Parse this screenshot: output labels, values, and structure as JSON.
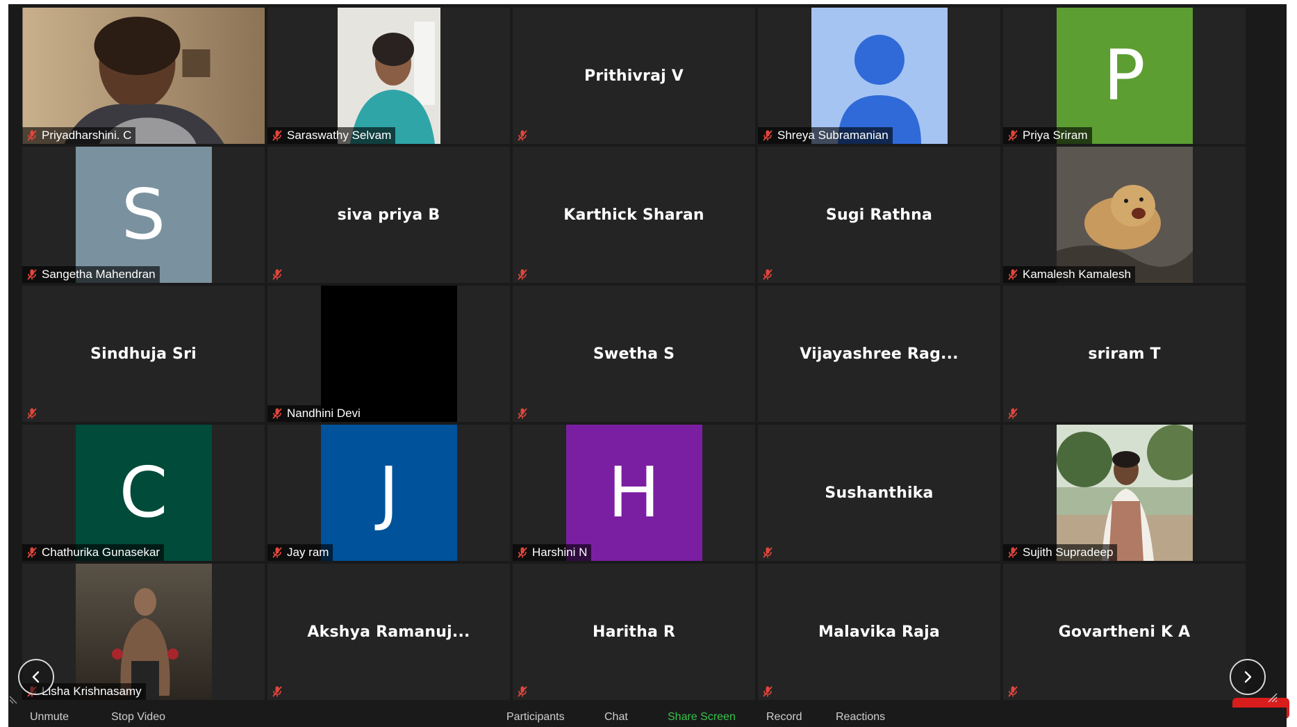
{
  "participants": [
    {
      "name": "Priyadharshini. C",
      "type": "video",
      "media": "photo-woman-1",
      "muted": true
    },
    {
      "name": "Saraswathy Selvam",
      "type": "video",
      "media": "photo-woman-2",
      "muted": true
    },
    {
      "name": "Prithivraj V",
      "type": "name-only",
      "muted": true
    },
    {
      "name": "Shreya Subramanian",
      "type": "avatar-default",
      "muted": true
    },
    {
      "name": "Priya Sriram",
      "type": "letter",
      "letter": "P",
      "color": "#5c9e32",
      "muted": true
    },
    {
      "name": "Sangetha Mahendran",
      "type": "letter",
      "letter": "S",
      "color": "#7a929f",
      "muted": true
    },
    {
      "name": "siva priya B",
      "type": "name-only",
      "muted": true
    },
    {
      "name": "Karthick Sharan",
      "type": "name-only",
      "muted": true
    },
    {
      "name": "Sugi Rathna",
      "type": "name-only",
      "muted": true
    },
    {
      "name": "Kamalesh Kamalesh",
      "type": "video",
      "media": "photo-lion-cub",
      "muted": true
    },
    {
      "name": "Sindhuja Sri",
      "type": "name-only",
      "muted": true
    },
    {
      "name": "Nandhini Devi",
      "type": "video",
      "media": "black-screen",
      "muted": true
    },
    {
      "name": "Swetha S",
      "type": "name-only",
      "muted": true
    },
    {
      "name": "Vijayashree  Rag...",
      "type": "name-only",
      "muted": false
    },
    {
      "name": "sriram T",
      "type": "name-only",
      "muted": true
    },
    {
      "name": "Chathurika Gunasekar",
      "type": "letter",
      "letter": "C",
      "color": "#004b3a",
      "muted": true
    },
    {
      "name": "Jay ram",
      "type": "letter",
      "letter": "J",
      "color": "#00529b",
      "muted": true
    },
    {
      "name": "Harshini N",
      "type": "letter",
      "letter": "H",
      "color": "#7b1fa2",
      "muted": true
    },
    {
      "name": "Sushanthika",
      "type": "name-only",
      "muted": true
    },
    {
      "name": "Sujith Supradeep",
      "type": "video",
      "media": "photo-man-outdoor",
      "muted": true
    },
    {
      "name": "Lisha Krishnasamy",
      "type": "video",
      "media": "photo-movie-poster",
      "muted": true
    },
    {
      "name": "Akshya  Ramanuj...",
      "type": "name-only",
      "muted": true
    },
    {
      "name": "Haritha R",
      "type": "name-only",
      "muted": true
    },
    {
      "name": "Malavika Raja",
      "type": "name-only",
      "muted": true
    },
    {
      "name": "Govartheni K A",
      "type": "name-only",
      "muted": true
    }
  ],
  "toolbar": {
    "unmute": "Unmute",
    "stop_video": "Stop Video",
    "participants": "Participants",
    "chat": "Chat",
    "share_screen": "Share Screen",
    "record": "Record",
    "reactions": "Reactions"
  },
  "nav": {
    "prev_icon": "chevron-left-icon",
    "next_icon": "chevron-right-icon"
  },
  "colors": {
    "background": "#1a1a1a",
    "tile": "#242424",
    "share_screen": "#37c24a",
    "muted_mic": "#e0463c"
  }
}
